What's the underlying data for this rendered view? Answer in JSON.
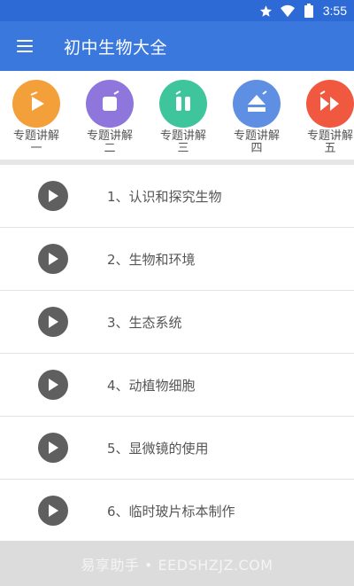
{
  "status_bar": {
    "time": "3:55",
    "icons": [
      "star-icon",
      "wifi-icon",
      "battery-icon"
    ]
  },
  "app_bar": {
    "title": "初中生物大全",
    "menu_icon": "menu-icon"
  },
  "topics": [
    {
      "label": "专题讲解",
      "sub": "一",
      "color": "#f4a03a",
      "icon": "play-icon"
    },
    {
      "label": "专题讲解",
      "sub": "二",
      "color": "#8f76dd",
      "icon": "stop-icon"
    },
    {
      "label": "专题讲解",
      "sub": "三",
      "color": "#3ec59b",
      "icon": "pause-icon"
    },
    {
      "label": "专题讲解",
      "sub": "四",
      "color": "#5f8fe3",
      "icon": "eject-icon"
    },
    {
      "label": "专题讲解",
      "sub": "五",
      "color": "#f0583f",
      "icon": "fast-forward-icon"
    }
  ],
  "list": [
    {
      "label": "1、认识和探究生物"
    },
    {
      "label": "2、生物和环境"
    },
    {
      "label": "3、生态系统"
    },
    {
      "label": "4、动植物细胞"
    },
    {
      "label": "5、显微镜的使用"
    },
    {
      "label": "6、临时玻片标本制作"
    }
  ],
  "watermark": "易享助手 • EEDSHZJZ.COM"
}
